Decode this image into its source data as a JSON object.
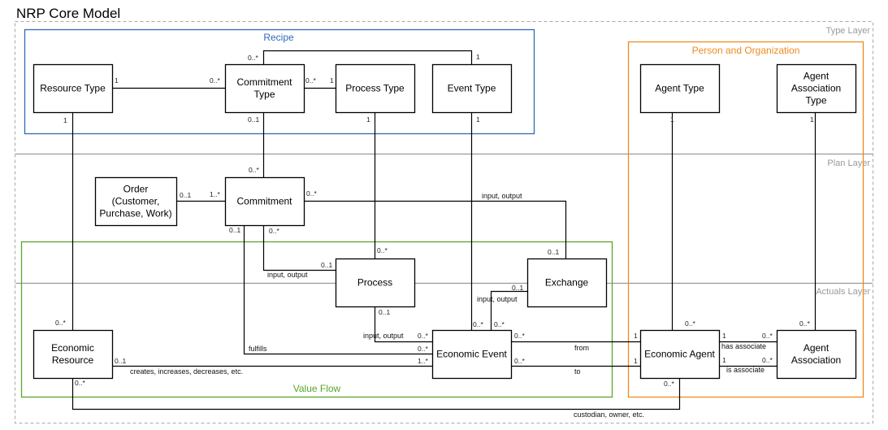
{
  "title": "NRP Core Model",
  "layers": {
    "type": "Type Layer",
    "plan": "Plan Layer",
    "actuals": "Actuals Layer"
  },
  "groups": {
    "recipe": {
      "label": "Recipe",
      "color": "#2e6bb5"
    },
    "person_org": {
      "label": "Person and Organization",
      "color": "#ef8a1c"
    },
    "value_flow": {
      "label": "Value Flow",
      "color": "#5aa52c"
    }
  },
  "classes": {
    "resource_type": [
      "Resource Type"
    ],
    "commitment_type": [
      "Commitment",
      "Type"
    ],
    "process_type": [
      "Process Type"
    ],
    "event_type": [
      "Event Type"
    ],
    "agent_type": [
      "Agent Type"
    ],
    "agent_association_type": [
      "Agent",
      "Association",
      "Type"
    ],
    "order": [
      "Order",
      "(Customer,",
      "Purchase, Work)"
    ],
    "commitment": [
      "Commitment"
    ],
    "process": [
      "Process"
    ],
    "exchange": [
      "Exchange"
    ],
    "economic_resource": [
      "Economic",
      "Resource"
    ],
    "economic_event": [
      "Economic Event"
    ],
    "economic_agent": [
      "Economic Agent"
    ],
    "agent_association": [
      "Agent",
      "Association"
    ]
  },
  "multiplicities": {
    "rt_ct_rt": "1",
    "rt_ct_ct": "0..*",
    "ct_et_ct": "0..*",
    "ct_et_et": "1",
    "ct_pt_ct": "0..*",
    "ct_pt_pt": "1",
    "rt_down": "1",
    "ct_down": "0..1",
    "pt_down": "1",
    "et_down": "1",
    "at_down": "1",
    "aat_down": "1",
    "com_top": "0..*",
    "order_com_order": "0..1",
    "order_com_com": "1..*",
    "com_exch_com": "0..*",
    "com_exch_exch": "0..1",
    "com_fulfills": "0..1",
    "com_proc_com": "0..*",
    "com_proc_proc": "0..1",
    "proc_top": "0..*",
    "proc_bottom": "0..1",
    "exch_left": "0..1",
    "ee_top_left": "0..*",
    "ee_top_right": "0..*",
    "ee_input": "0..*",
    "ee_fulfills": "0..*",
    "ee_creates": "1..*",
    "ee_from": "0..*",
    "ee_to": "0..*",
    "er_top": "0..*",
    "er_right": "0..1",
    "er_bottom": "0..*",
    "ea_from": "1",
    "ea_to": "1",
    "ea_top": "0..*",
    "ea_bottom": "0..*",
    "ea_has": "1",
    "ea_is": "1",
    "aa_has": "0..*",
    "aa_is": "0..*",
    "aa_top": "0..*"
  },
  "roles": {
    "com_exch": "input, output",
    "com_proc": "input, output",
    "exch_ee": "input, output",
    "proc_ee": "input, output",
    "fulfills": "fulfills",
    "creates": "creates, increases, decreases, etc.",
    "from": "from",
    "to": "to",
    "has_associate": "has associate",
    "is_associate": "is associate",
    "custodian": "custodian, owner, etc."
  }
}
